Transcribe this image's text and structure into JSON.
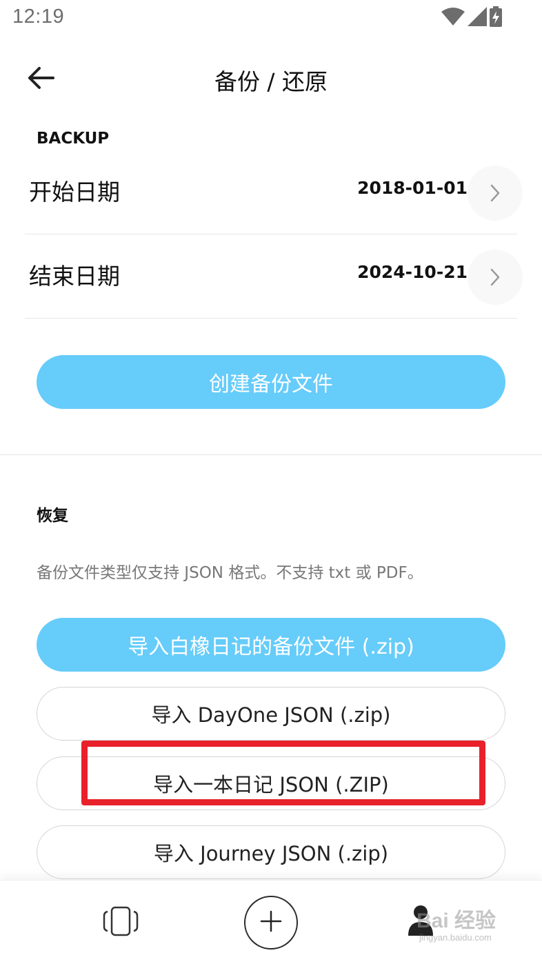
{
  "status_bar": {
    "time": "12:19",
    "icons": [
      "wifi-icon",
      "signal-icon",
      "battery-charging-icon"
    ]
  },
  "app_bar": {
    "back_icon": "arrow-left-icon",
    "title": "备份 / 还原"
  },
  "backup": {
    "section_label": "BACKUP",
    "start_date": {
      "label": "开始日期",
      "value": "2018-01-01"
    },
    "end_date": {
      "label": "结束日期",
      "value": "2024-10-21"
    },
    "create_button": "创建备份文件"
  },
  "restore": {
    "section_label": "恢复",
    "note": "备份文件类型仅支持 JSON 格式。不支持 txt 或 PDF。",
    "import_buttons": [
      "导入白橡日记的备份文件 (.zip)",
      "导入 DayOne JSON (.zip)",
      "导入一本日记 JSON (.ZIP)",
      "导入 Journey JSON (.zip)"
    ]
  },
  "bottom_nav": {
    "icons": [
      "cards-icon",
      "add-icon",
      "profile-icon"
    ]
  },
  "watermark": {
    "text": "Bai 经验",
    "sub": "jingyan.baidu.com"
  },
  "colors": {
    "accent": "#66ccfa",
    "highlight": "#e8212b"
  }
}
